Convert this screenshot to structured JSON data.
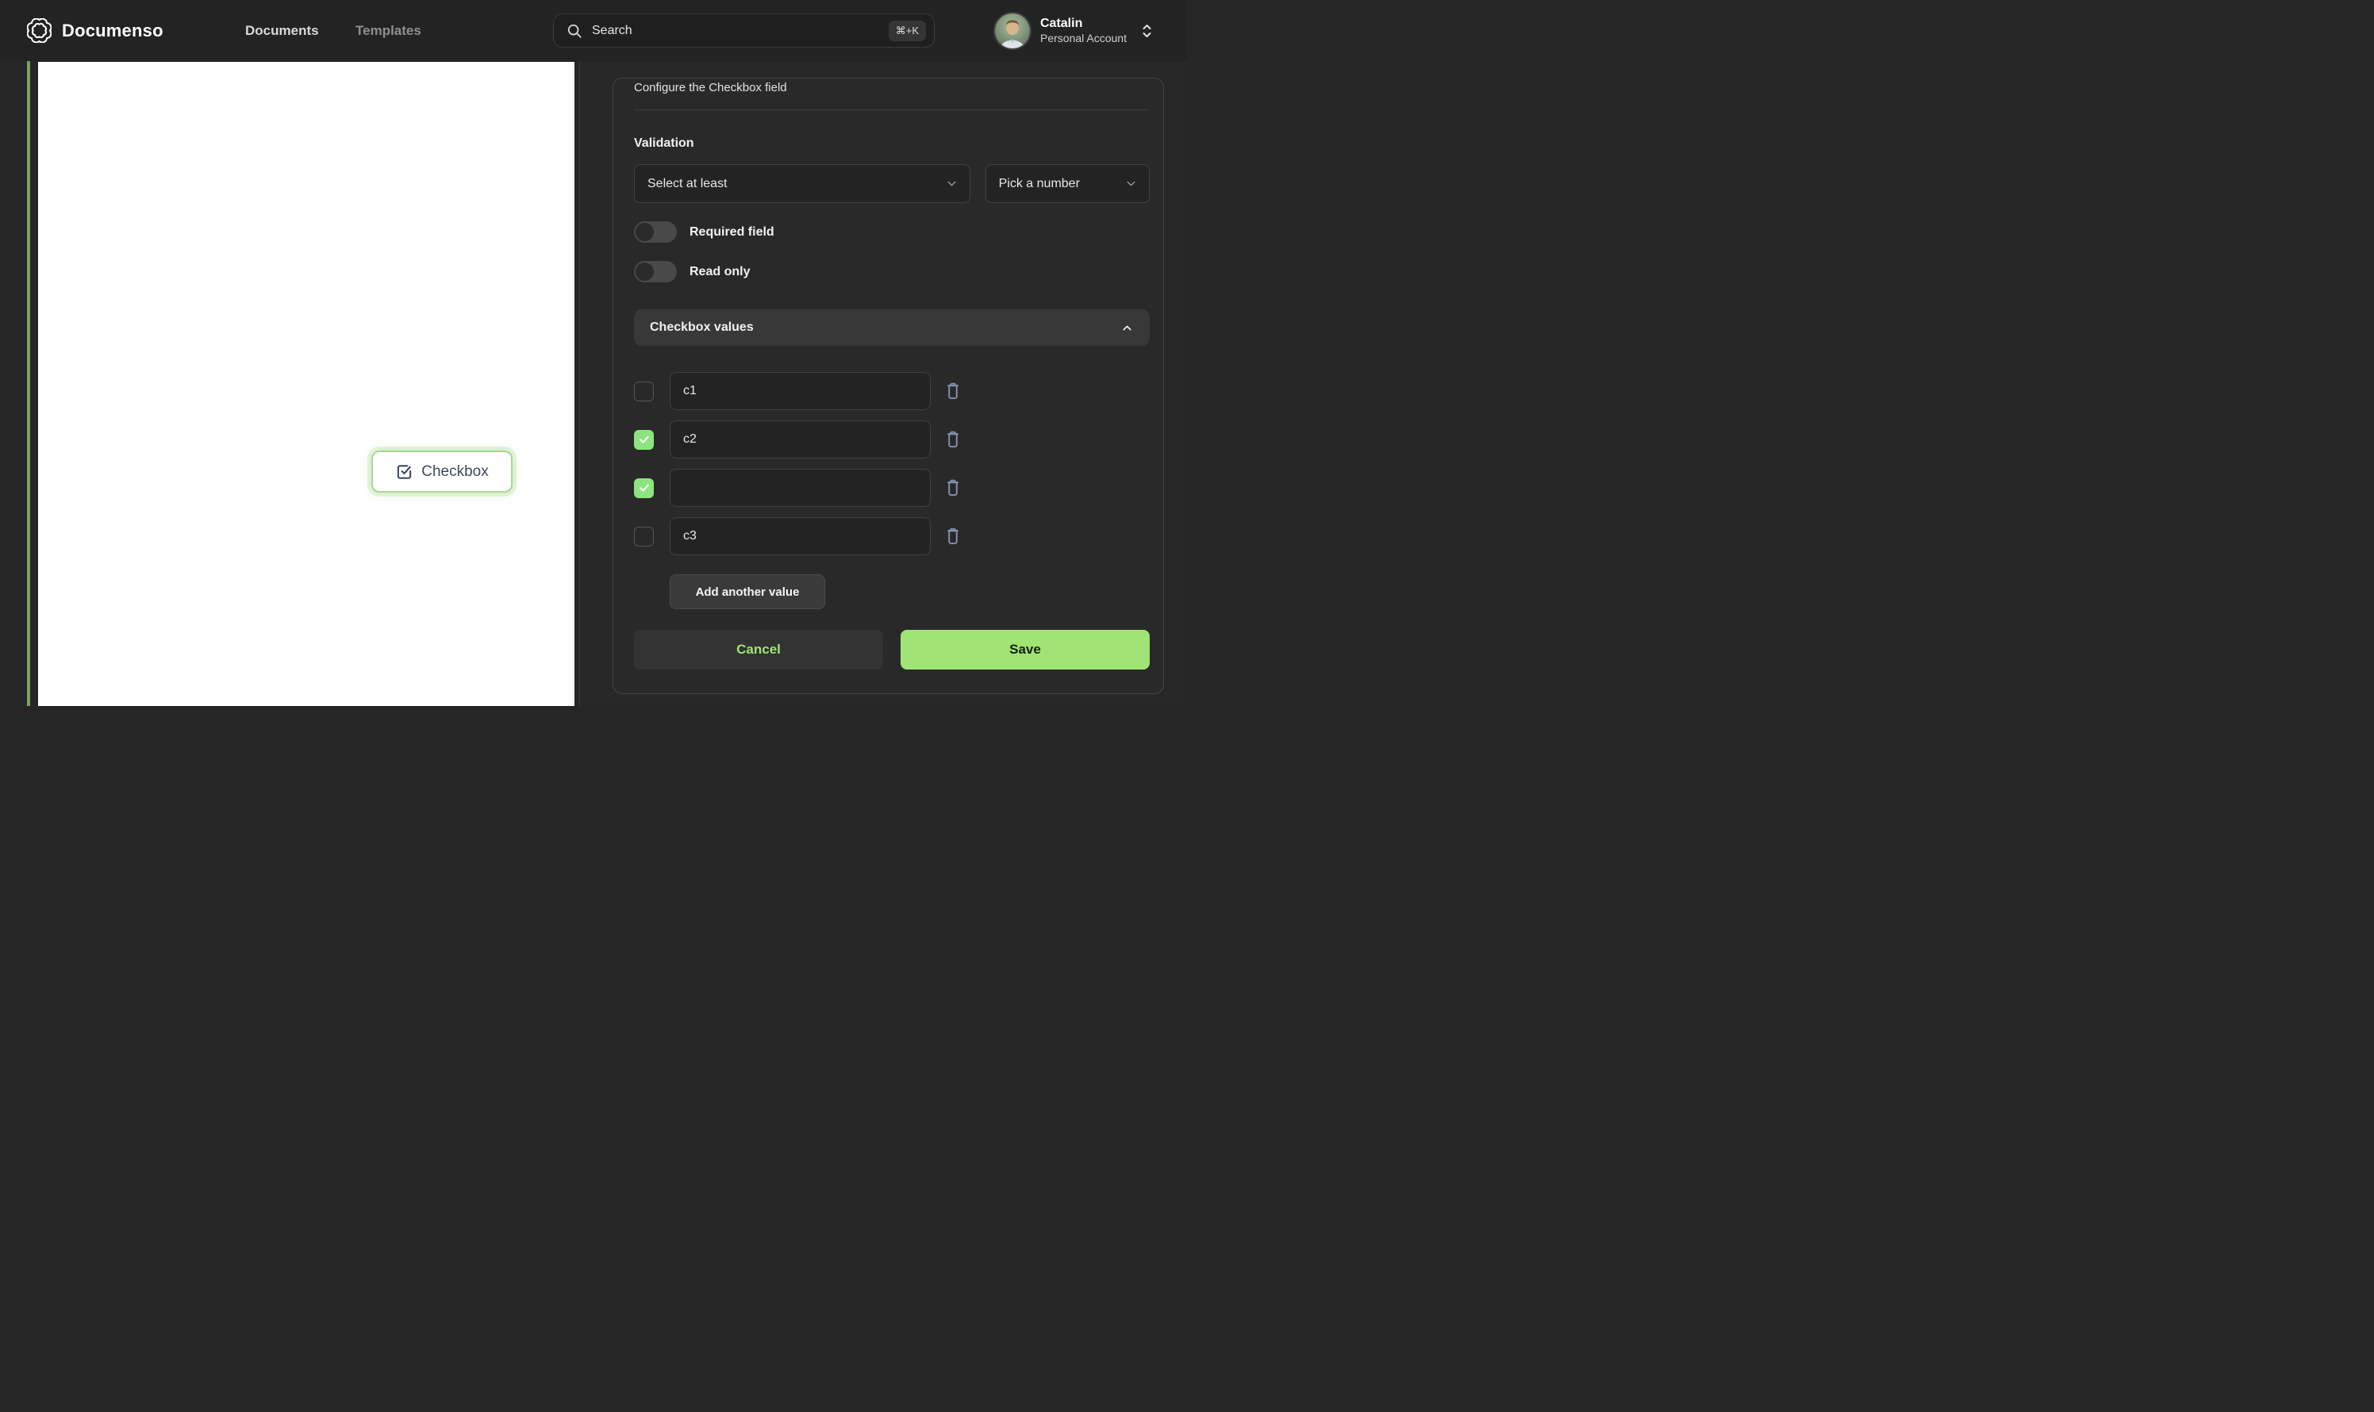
{
  "header": {
    "brand": "Documenso",
    "nav": [
      {
        "label": "Documents",
        "active": true
      },
      {
        "label": "Templates",
        "active": false
      }
    ],
    "search": {
      "placeholder": "Search",
      "shortcut": "⌘+K"
    },
    "user": {
      "name": "Catalin",
      "account_type": "Personal Account"
    }
  },
  "document": {
    "field": {
      "label": "Checkbox"
    }
  },
  "panel": {
    "title": "Configure the Checkbox field",
    "validation": {
      "label": "Validation",
      "rule_selected": "Select at least",
      "number_selected": "Pick a number"
    },
    "toggles": [
      {
        "label": "Required field",
        "on": false
      },
      {
        "label": "Read only",
        "on": false
      }
    ],
    "values_section": {
      "title": "Checkbox values",
      "expanded": true
    },
    "values": [
      {
        "checked": false,
        "value": "c1"
      },
      {
        "checked": true,
        "value": "c2"
      },
      {
        "checked": true,
        "value": ""
      },
      {
        "checked": false,
        "value": "c3"
      }
    ],
    "add_button": "Add another value",
    "cancel_button": "Cancel",
    "save_button": "Save"
  },
  "colors": {
    "save_green": "#a0e476",
    "check_green": "#8ce57e",
    "cancel_text_green": "#9fe573",
    "field_border_green": "#abd795",
    "rail_green": "#7ba262",
    "trash_icon": "#8095af"
  }
}
